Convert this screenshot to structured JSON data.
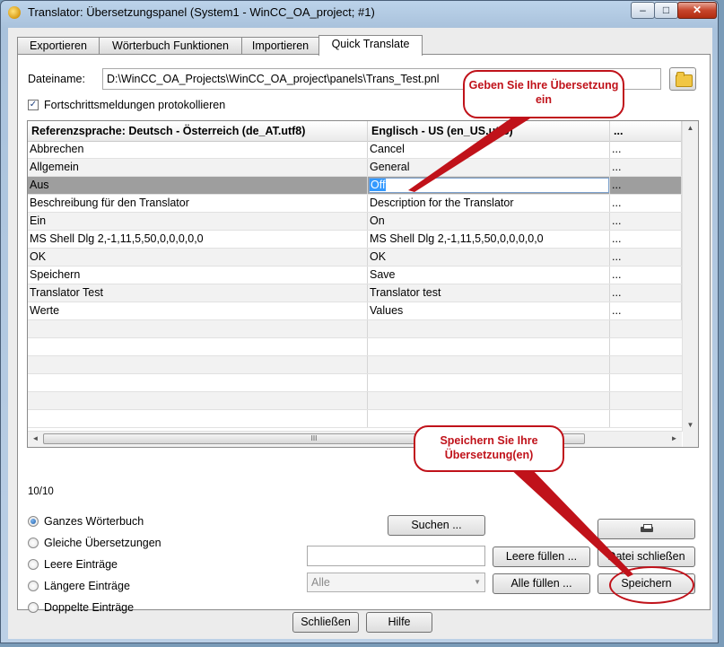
{
  "window": {
    "title": "Translator: Übersetzungspanel (System1 - WinCC_OA_project; #1)",
    "controls": {
      "minimize": "–",
      "maximize": "□",
      "close": "✕"
    }
  },
  "tabs": [
    {
      "label": "Exportieren",
      "active": false
    },
    {
      "label": "Wörterbuch Funktionen",
      "active": false
    },
    {
      "label": "Importieren",
      "active": false
    },
    {
      "label": "Quick Translate",
      "active": true
    }
  ],
  "file": {
    "label": "Dateiname:",
    "value": "D:\\WinCC_OA_Projects\\WinCC_OA_project\\panels\\Trans_Test.pnl",
    "browse_icon": "folder-icon"
  },
  "log_checkbox": {
    "label": "Fortschrittsmeldungen protokollieren",
    "checked": true,
    "mark": "✓"
  },
  "table": {
    "headers": [
      "Referenzsprache: Deutsch - Österreich (de_AT.utf8)",
      "Englisch - US (en_US.utf8)",
      "..."
    ],
    "rows": [
      [
        "Abbrechen",
        "Cancel",
        "..."
      ],
      [
        "Allgemein",
        "General",
        "..."
      ],
      [
        "Aus",
        "Off",
        "..."
      ],
      [
        "Beschreibung für den Translator",
        "Description for the Translator",
        "..."
      ],
      [
        "Ein",
        "On",
        "..."
      ],
      [
        "MS Shell Dlg 2,-1,11,5,50,0,0,0,0,0",
        "MS Shell Dlg 2,-1,11,5,50,0,0,0,0,0",
        "..."
      ],
      [
        "OK",
        "OK",
        "..."
      ],
      [
        "Speichern",
        "Save",
        "..."
      ],
      [
        "Translator Test",
        "Translator test",
        "..."
      ],
      [
        "Werte",
        "Values",
        "..."
      ]
    ],
    "selected_row": 2,
    "edit_value": "Off",
    "empty_rows": 6,
    "scroll": {
      "up": "▲",
      "down": "▼",
      "left": "◄",
      "right": "►",
      "thumb_grip": "III"
    }
  },
  "count": "10/10",
  "filter_options": [
    {
      "label": "Ganzes Wörterbuch",
      "selected": true
    },
    {
      "label": "Gleiche Übersetzungen",
      "selected": false
    },
    {
      "label": "Leere Einträge",
      "selected": false
    },
    {
      "label": "Längere Einträge",
      "selected": false
    },
    {
      "label": "Doppelte Einträge",
      "selected": false
    }
  ],
  "buttons": {
    "search": "Suchen ...",
    "fill_empty": "Leere füllen ...",
    "fill_all": "Alle füllen ...",
    "close_file": "Datei schließen",
    "save": "Speichern",
    "print_icon": "printer-icon",
    "close": "Schließen",
    "help": "Hilfe"
  },
  "fill_input": {
    "value": ""
  },
  "combo": {
    "value": "Alle",
    "arrow": "▼"
  },
  "callouts": {
    "enter_translation": "Geben Sie Ihre Übersetzung ein",
    "save_translation": "Speichern Sie Ihre Übersetzung(en)"
  },
  "colors": {
    "annotation": "#c0121a",
    "selection": "#9e9e9e",
    "edit_highlight": "#3399ff"
  }
}
